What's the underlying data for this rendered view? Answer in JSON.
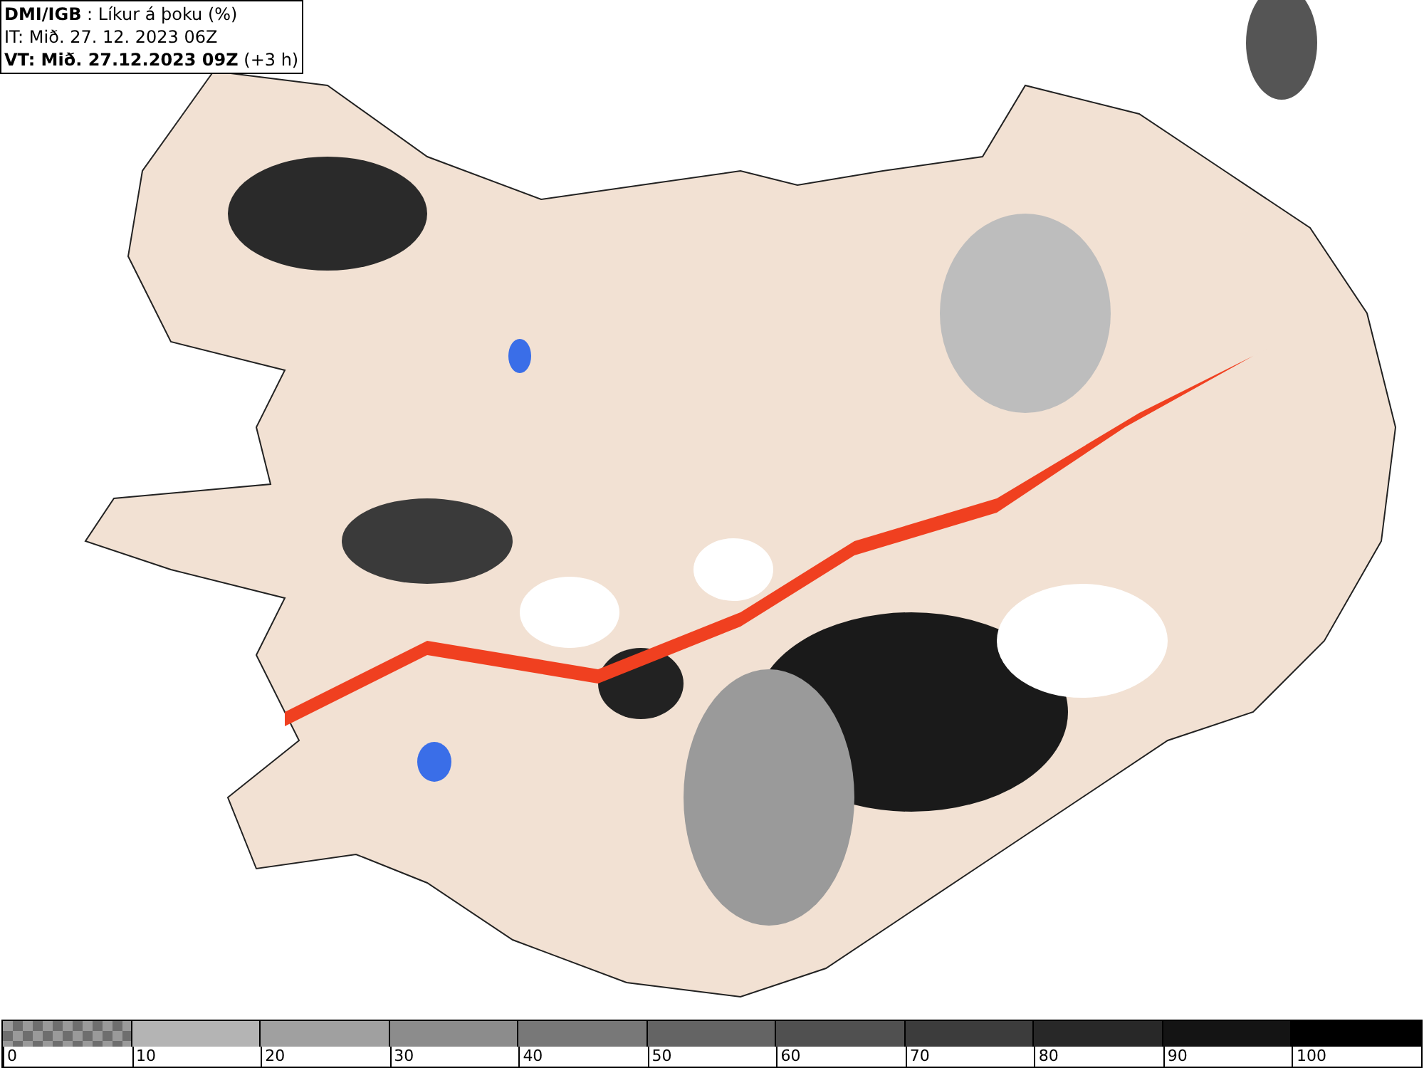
{
  "info_box": {
    "lines": [
      "**DMI/IGB** : Líkur á þoku (%)",
      "IT: Mið. 27. 12. 2023 06Z",
      "**VT: Mið. 27.12.2023 09Z** (+3 h)"
    ]
  },
  "legend": {
    "segments": [
      {
        "kind": "checker",
        "label": "0"
      },
      {
        "kind": "solid",
        "color": "#b4b4b4",
        "label": "10"
      },
      {
        "kind": "solid",
        "color": "#a0a0a0",
        "label": "20"
      },
      {
        "kind": "solid",
        "color": "#8c8c8c",
        "label": "30"
      },
      {
        "kind": "solid",
        "color": "#787878",
        "label": "40"
      },
      {
        "kind": "solid",
        "color": "#646464",
        "label": "50"
      },
      {
        "kind": "solid",
        "color": "#505050",
        "label": "60"
      },
      {
        "kind": "solid",
        "color": "#3c3c3c",
        "label": "70"
      },
      {
        "kind": "solid",
        "color": "#282828",
        "label": "80"
      },
      {
        "kind": "solid",
        "color": "#141414",
        "label": "90"
      },
      {
        "kind": "solid",
        "color": "#000000",
        "label": "100"
      }
    ]
  }
}
